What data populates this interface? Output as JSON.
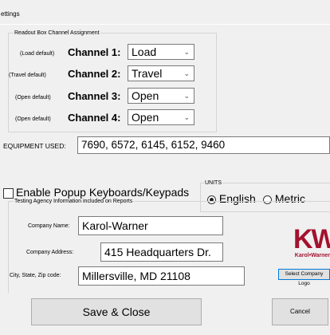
{
  "window": {
    "title": "ettings"
  },
  "channels_group": {
    "legend": "Readout Box Channel Assignment",
    "rows": [
      {
        "hint": "(Load default)",
        "label": "Channel 1:",
        "value": "Load"
      },
      {
        "hint": "(Travel default)",
        "label": "Channel 2:",
        "value": "Travel"
      },
      {
        "hint": "(Open default)",
        "label": "Channel 3:",
        "value": "Open"
      },
      {
        "hint": "(Open default)",
        "label": "Channel 4:",
        "value": "Open"
      }
    ]
  },
  "equipment": {
    "label": "EQUIPMENT USED:",
    "value": "7690, 6572, 6145, 6152, 9460"
  },
  "popup": {
    "label": "Enable Popup Keyboards/Keypads",
    "checked": false
  },
  "units": {
    "legend": "UNITS",
    "options": [
      "English",
      "Metric"
    ],
    "selected": "English"
  },
  "agency": {
    "legend": "Testing Agency Information included on Reports",
    "company_name_label": "Company Name:",
    "company_name": "Karol-Warner",
    "company_address_label": "Company Address:",
    "company_address": "415 Headquarters Dr.",
    "city_label": "City, State, Zip code:",
    "city": "Millersville, MD 21108"
  },
  "logo": {
    "text": "KW",
    "subtext": "Karol•Warner",
    "color": "#a3122e"
  },
  "buttons": {
    "select_logo": "Select Company Logo",
    "save": "Save & Close",
    "cancel": "Cancel"
  },
  "icons": {
    "dropdown": "chevron-down-icon"
  }
}
